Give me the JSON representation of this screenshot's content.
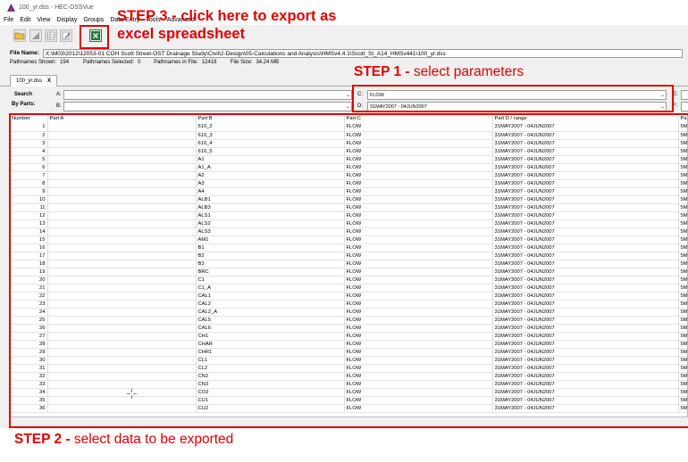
{
  "window": {
    "title": "100_yr.dss - HEC-DSSVue"
  },
  "menu": [
    "File",
    "Edit",
    "View",
    "Display",
    "Groups",
    "Data Entry",
    "Tools",
    "Advanced"
  ],
  "file": {
    "label": "File Name:",
    "path": "X:\\M03\\2012\\12053-01 COH Scott Street-OST Drainage Study\\Civil\\2-Design\\05-Calculations and Analysis\\HMSv4.4.1\\Scott_St_A14_HMSv441\\100_yr.dss"
  },
  "stats": {
    "shown_label": "Pathnames Shown:",
    "shown": "194",
    "selected_label": "Pathnames Selected:",
    "selected": "0",
    "infile_label": "Pathnames in File:",
    "infile": "12418",
    "size_label": "File Size:",
    "size": "34.24 MB"
  },
  "tab": {
    "label": "100_yr.dss",
    "close": "X"
  },
  "search": {
    "label": "Search",
    "byparts": "By Parts:",
    "a_label": "A:",
    "b_label": "B:",
    "c_label": "C:",
    "d_label": "D:",
    "e_label": "E:",
    "f_label": "F:",
    "a_value": "",
    "b_value": "",
    "c_value": "FLOW",
    "d_value": "31MAY2007 - 04JUN2007",
    "e_value": "",
    "f_value": ""
  },
  "table": {
    "headers": [
      "Number",
      "Part A",
      "Part B",
      "Part C",
      "Part D / range",
      "Pa"
    ],
    "part_c": "FLOW",
    "part_d": "31MAY2007 - 04JUN2007",
    "part_e": "5M",
    "rows": [
      {
        "n": "1",
        "b": "610_2"
      },
      {
        "n": "2",
        "b": "610_3"
      },
      {
        "n": "3",
        "b": "610_4"
      },
      {
        "n": "4",
        "b": "610_5"
      },
      {
        "n": "5",
        "b": "A1"
      },
      {
        "n": "6",
        "b": "A1_A"
      },
      {
        "n": "7",
        "b": "A2"
      },
      {
        "n": "8",
        "b": "A3"
      },
      {
        "n": "9",
        "b": "A4"
      },
      {
        "n": "10",
        "b": "ALB1"
      },
      {
        "n": "11",
        "b": "ALB3"
      },
      {
        "n": "12",
        "b": "ALS1"
      },
      {
        "n": "13",
        "b": "ALS2"
      },
      {
        "n": "14",
        "b": "ALS3"
      },
      {
        "n": "15",
        "b": "AM1"
      },
      {
        "n": "16",
        "b": "B1"
      },
      {
        "n": "17",
        "b": "B2"
      },
      {
        "n": "18",
        "b": "B3"
      },
      {
        "n": "19",
        "b": "BRC"
      },
      {
        "n": "20",
        "b": "C1"
      },
      {
        "n": "21",
        "b": "C1_A"
      },
      {
        "n": "22",
        "b": "CAL1"
      },
      {
        "n": "23",
        "b": "CAL2"
      },
      {
        "n": "24",
        "b": "CAL2_A"
      },
      {
        "n": "25",
        "b": "CAL5"
      },
      {
        "n": "26",
        "b": "CAL6"
      },
      {
        "n": "27",
        "b": "CH1"
      },
      {
        "n": "28",
        "b": "CHAR"
      },
      {
        "n": "29",
        "b": "CHR1"
      },
      {
        "n": "30",
        "b": "CL1"
      },
      {
        "n": "31",
        "b": "CL2"
      },
      {
        "n": "32",
        "b": "CN2"
      },
      {
        "n": "33",
        "b": "CN3"
      },
      {
        "n": "34",
        "b": "CO2"
      },
      {
        "n": "35",
        "b": "CU1"
      },
      {
        "n": "36",
        "b": "CU2"
      }
    ]
  },
  "annotations": {
    "step3_line1": "STEP 3 - click here to export as",
    "step3_line2": "excel spreadsheet",
    "step1_bold": "STEP 1 -",
    "step1_text": " select parameters",
    "step2_bold": "STEP 2 -",
    "step2_text": " select data to be exported",
    "color": "#e00000"
  }
}
